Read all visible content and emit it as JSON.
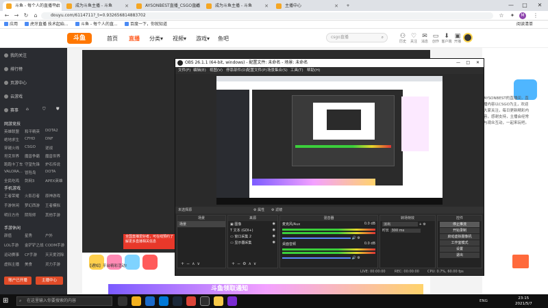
{
  "browser": {
    "tabs": [
      {
        "label": "斗鱼 - 每个人的直播平台"
      },
      {
        "label": "成为斗鱼主播 - 斗鱼"
      },
      {
        "label": "AYSONBEST直播_CSGO直播"
      },
      {
        "label": "成为斗鱼主播 - 斗鱼"
      },
      {
        "label": "主播中心"
      }
    ],
    "new_tab": "+",
    "url": "douyu.com/6114711?_t=0.932656814883702",
    "bookmarks": [
      "应用",
      "虎牙直播 技术起始...",
      "斗鱼 - 每个人的直...",
      "百度一下，你就知道"
    ],
    "reading_list": "阅读清单",
    "window_controls": {
      "minimize": "—",
      "maximize": "□",
      "close": "✕"
    }
  },
  "douyu": {
    "logo": "斗鱼",
    "nav": [
      {
        "label": "首页",
        "active": false
      },
      {
        "label": "直播",
        "active": true
      },
      {
        "label": "分类▾",
        "active": false
      },
      {
        "label": "视频▾",
        "active": false
      },
      {
        "label": "游戏▾",
        "active": false
      },
      {
        "label": "鱼吧",
        "active": false
      }
    ],
    "search_placeholder": "csgo直播",
    "header_icons": [
      {
        "icon": "⚇",
        "label": "历史"
      },
      {
        "icon": "♡",
        "label": "关注"
      },
      {
        "icon": "✉",
        "label": "消息"
      },
      {
        "icon": "▭",
        "label": "创作"
      },
      {
        "icon": "⬇",
        "label": "客户端"
      },
      {
        "icon": "▣",
        "label": "开播"
      }
    ],
    "sidebar": {
      "top_items": [
        "我的关注",
        "排行榜",
        "页游中心",
        "云游戏"
      ],
      "mini_icons": [
        "赛事",
        "⌂",
        "⛉",
        "⛊"
      ],
      "section_hot": "网游竞技",
      "hot_grid": [
        "英雄联盟",
        "和平精英",
        "DOTA2",
        "绝地求生",
        "CFHD",
        "DNF",
        "穿越火线",
        "CSGO",
        "逆战",
        "坦克世界",
        "魔兽争霸",
        "魔兽世界",
        "跑跑卡丁车",
        "守望先锋",
        "炉石传说",
        "VALORA...",
        "冒险岛",
        "DOTA",
        "全民吃鸡",
        "剑网3",
        "APEX英雄"
      ],
      "section_mobile": "手机游戏",
      "mobile_grid": [
        "王者荣耀",
        "火影忍者",
        "原神游戏",
        "手游休闲",
        "梦幻西游",
        "王者模拟",
        "明日方舟",
        "阴阳师",
        "其他手游"
      ],
      "section_pc": "手游休闲",
      "pc_grid": [
        "颜值",
        "星秀",
        "户外",
        "LOL手游",
        "金铲铲之战",
        "CODM手游",
        "运动赛事",
        "CF手游",
        "天天爱消除",
        "虚拟主播",
        "美食",
        "灵力手游"
      ],
      "buttons": [
        "账户已开播",
        "主播中心"
      ]
    },
    "side_text": "AYSONBEST的直播间，直播内容以CSGO为主，欢迎大家关注，每日更新精彩内容，感谢支持，主播会经常与观众互动，一起来玩吧。",
    "big_text": [
      "微",
      "Q群",
      "分辨"
    ],
    "red_box": "全国直播爱好者，可在线预约了解更多直播相关信息",
    "bottom_link": "【通知】平台精彩活动!",
    "banner": "斗鱼领取通知"
  },
  "obs": {
    "title": "OBS 26.1.1 (64-bit, windows) - 配置文件: 未命名 - 场景: 未命名",
    "menu": [
      "文件(F)",
      "编辑(E)",
      "视图(V)",
      "停靠部件(D)",
      "配置文件(P)",
      "场景集合(S)",
      "工具(T)",
      "帮助(H)"
    ],
    "controls_bar": {
      "no_source": "未选择源",
      "props": "属性",
      "filters": "滤镜"
    },
    "docks": {
      "scenes": {
        "title": "场景",
        "items": [
          "场景"
        ]
      },
      "sources": {
        "title": "来源",
        "items": [
          "图像",
          "文本 (GDI+)",
          "窗口采集 2",
          "显示器采集"
        ]
      },
      "mixer": {
        "title": "混音器",
        "channels": [
          {
            "name": "麦克风/Aux",
            "db": "0.0 dB"
          },
          {
            "name": "桌面音频",
            "db": "0.0 dB"
          }
        ]
      },
      "transitions": {
        "title": "转场特效",
        "type": "淡出",
        "duration_label": "时长",
        "duration": "300 ms"
      },
      "controls": {
        "title": "控件",
        "buttons": [
          "停止推流",
          "开始录制",
          "启动虚拟摄像机",
          "工作室模式",
          "设置",
          "退出"
        ]
      }
    },
    "status": {
      "live": "LIVE: 00:00:00",
      "rec": "REC: 00:00:00",
      "cpu": "CPU: 0.7%, 60.00 fps"
    }
  },
  "taskbar": {
    "start": "⊞",
    "search_placeholder": "在这里输入你要搜索的内容",
    "tray": "ENG",
    "time": "23:15",
    "date": "2021/5/7"
  }
}
